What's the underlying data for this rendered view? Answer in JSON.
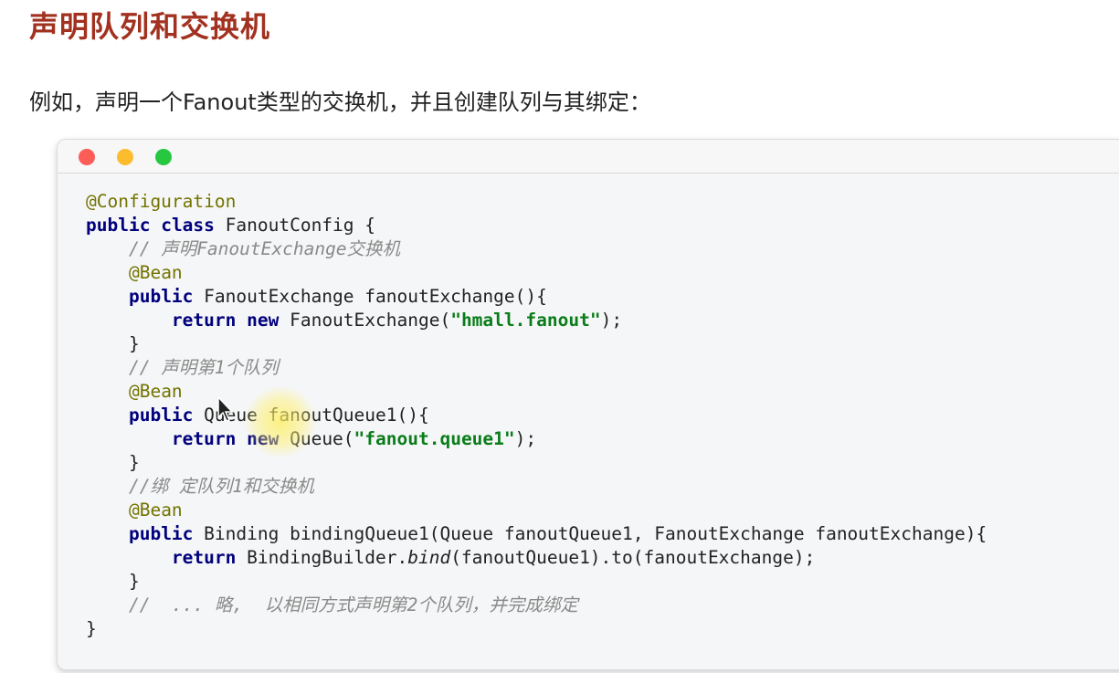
{
  "heading": "声明队列和交换机",
  "intro": "例如，声明一个Fanout类型的交换机，并且创建队列与其绑定：",
  "code_lines": [
    [
      {
        "t": "@Configuration",
        "c": "ann"
      }
    ],
    [
      {
        "t": "public",
        "c": "kw"
      },
      {
        "t": " "
      },
      {
        "t": "class",
        "c": "kw"
      },
      {
        "t": " FanoutConfig {"
      }
    ],
    [
      {
        "t": "    "
      },
      {
        "t": "// 声明FanoutExchange交换机",
        "c": "com"
      }
    ],
    [
      {
        "t": "    "
      },
      {
        "t": "@Bean",
        "c": "ann"
      }
    ],
    [
      {
        "t": "    "
      },
      {
        "t": "public",
        "c": "kw"
      },
      {
        "t": " FanoutExchange fanoutExchange(){"
      }
    ],
    [
      {
        "t": "        "
      },
      {
        "t": "return",
        "c": "kw"
      },
      {
        "t": " "
      },
      {
        "t": "new",
        "c": "kw"
      },
      {
        "t": " FanoutExchange("
      },
      {
        "t": "\"hmall.fanout\"",
        "c": "str"
      },
      {
        "t": ");"
      }
    ],
    [
      {
        "t": "    }"
      }
    ],
    [
      {
        "t": "    "
      },
      {
        "t": "// 声明第1个队列",
        "c": "com"
      }
    ],
    [
      {
        "t": "    "
      },
      {
        "t": "@Bean",
        "c": "ann"
      }
    ],
    [
      {
        "t": "    "
      },
      {
        "t": "public",
        "c": "kw"
      },
      {
        "t": " Queue fanoutQueue1(){"
      }
    ],
    [
      {
        "t": "        "
      },
      {
        "t": "return",
        "c": "kw"
      },
      {
        "t": " "
      },
      {
        "t": "new",
        "c": "kw"
      },
      {
        "t": " Queue("
      },
      {
        "t": "\"fanout.queue1\"",
        "c": "str"
      },
      {
        "t": ");"
      }
    ],
    [
      {
        "t": "    }"
      }
    ],
    [
      {
        "t": "    "
      },
      {
        "t": "//绑 定队列1和交换机",
        "c": "com"
      }
    ],
    [
      {
        "t": "    "
      },
      {
        "t": "@Bean",
        "c": "ann"
      }
    ],
    [
      {
        "t": "    "
      },
      {
        "t": "public",
        "c": "kw"
      },
      {
        "t": " Binding bindingQueue1(Queue fanoutQueue1, FanoutExchange fanoutExchange){"
      }
    ],
    [
      {
        "t": "        "
      },
      {
        "t": "return",
        "c": "kw"
      },
      {
        "t": " BindingBuilder."
      },
      {
        "t": "bind",
        "c": "it"
      },
      {
        "t": "(fanoutQueue1).to(fanoutExchange);"
      }
    ],
    [
      {
        "t": "    }"
      }
    ],
    [
      {
        "t": "    "
      },
      {
        "t": "//  ... 略,  以相同方式声明第2个队列，并完成绑定",
        "c": "com"
      }
    ],
    [
      {
        "t": "}"
      }
    ]
  ],
  "colors": {
    "heading": "#a2311f",
    "keyword": "#00007d",
    "annotation": "#737300",
    "comment": "#8a8a8a",
    "string": "#0a7d1a",
    "window_red": "#fc5d57",
    "window_yellow": "#fdbc2e",
    "window_green": "#27c840"
  },
  "icons": {
    "window_controls": [
      "close-dot-icon",
      "minimize-dot-icon",
      "maximize-dot-icon"
    ],
    "cursor": "mouse-cursor-icon"
  }
}
